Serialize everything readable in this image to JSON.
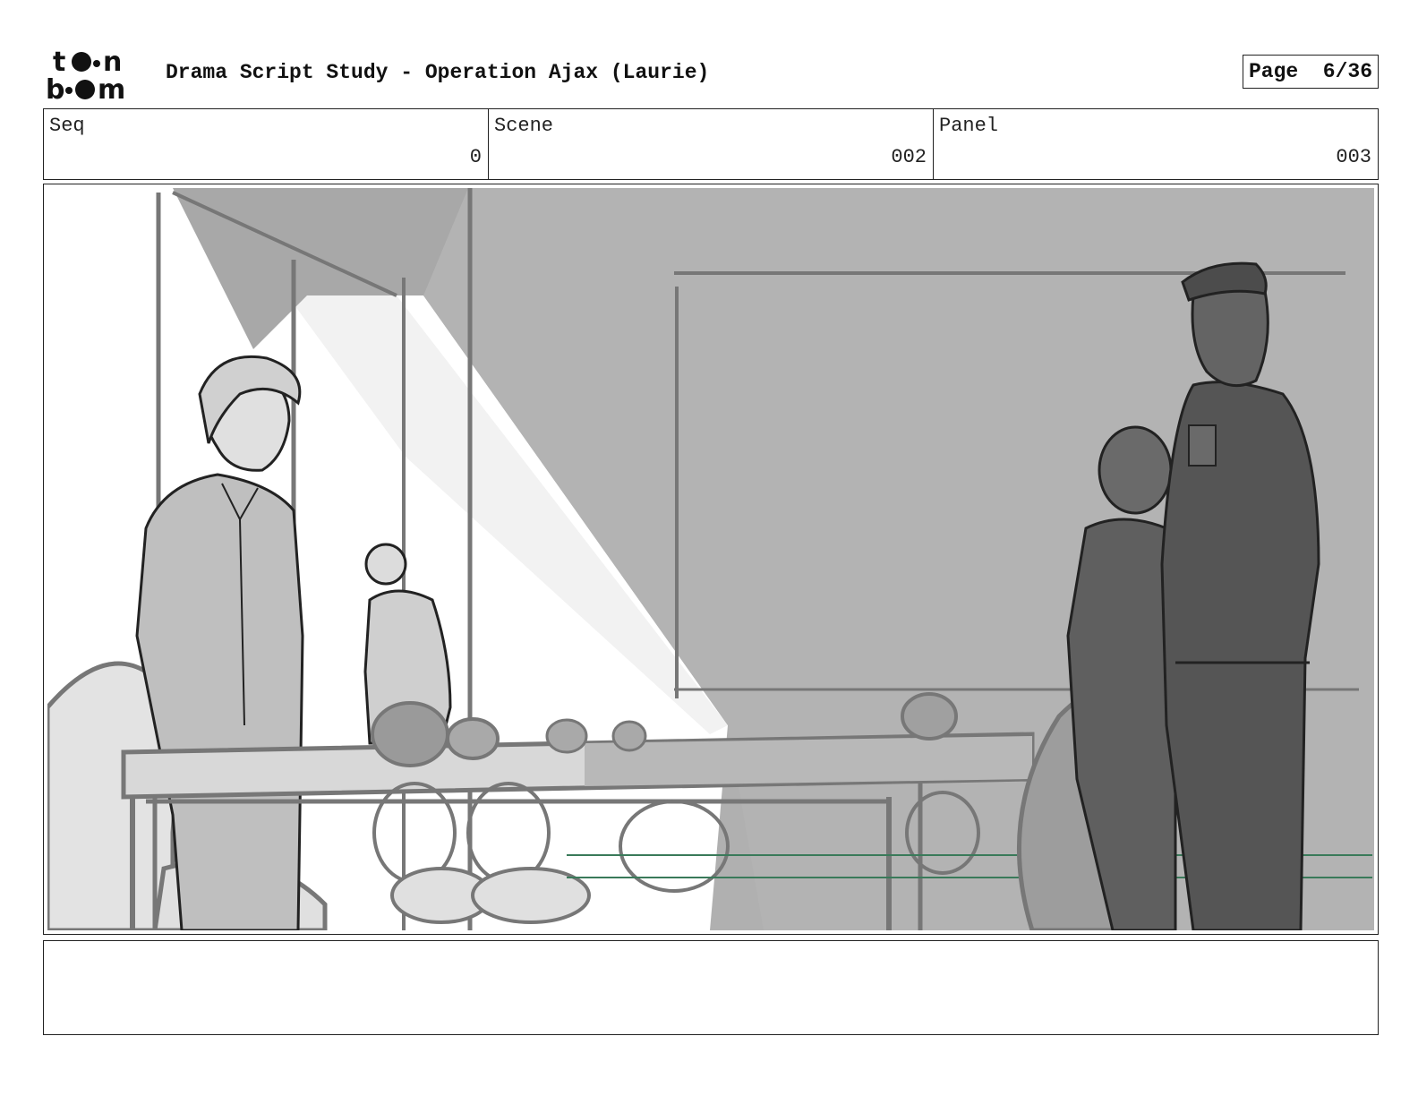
{
  "header": {
    "logo_text": "toon boom",
    "title": "Drama Script Study - Operation Ajax (Laurie)",
    "page_label": "Page",
    "page_number": "6/36"
  },
  "info": {
    "seq_label": "Seq",
    "seq_value": "0",
    "scene_label": "Scene",
    "scene_value": "002",
    "panel_label": "Panel",
    "panel_value": "003"
  },
  "notes": {
    "text": ""
  }
}
